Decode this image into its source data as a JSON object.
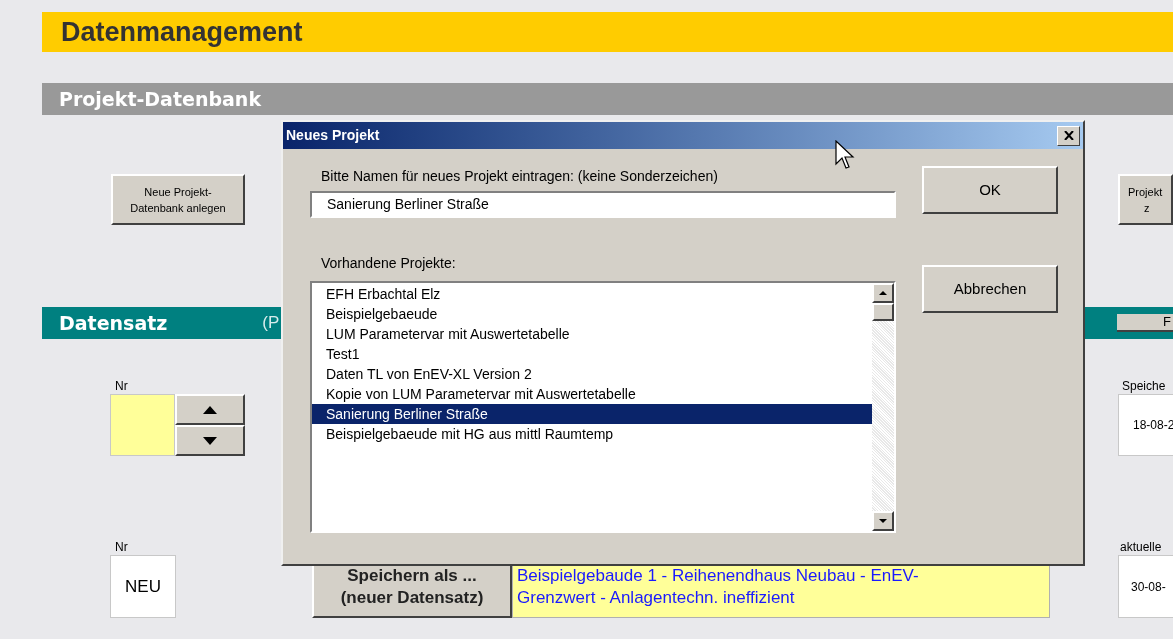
{
  "page_title": "Datenmanagement",
  "project_db": {
    "title": "Projekt-Datenbank",
    "buttons": [
      {
        "lines": [
          "Neue Projekt-",
          "Datenbank anlegen"
        ]
      },
      {
        "lines": [
          "Projekt",
          "z"
        ]
      }
    ]
  },
  "record": {
    "title": "Datensatz",
    "subtitle": "(P",
    "button": "F",
    "nr_label": "Nr",
    "saved_label": "Speiche",
    "saved_value": "18-08-2",
    "new_nr_label": "Nr",
    "new_nr_value": "NEU",
    "save_as_button": [
      "Speichern als ...",
      "(neuer Datensatz)"
    ],
    "description": "Beispielgebaude 1 - Reihenendhaus Neubau - EnEV-Grenzwert - Anlagentechn. ineffizient",
    "current_label": "aktuelle",
    "current_value": "30-08-"
  },
  "dialog": {
    "title": "Neues Projekt",
    "prompt": "Bitte Namen für neues Projekt eintragen: (keine Sonderzeichen)",
    "name_value": "Sanierung Berliner Straße",
    "list_label": "Vorhandene Projekte:",
    "projects": [
      {
        "name": "EFH Erbachtal Elz",
        "selected": false
      },
      {
        "name": "Beispielgebaeude",
        "selected": false
      },
      {
        "name": "LUM Parametervar mit Auswertetabelle",
        "selected": false
      },
      {
        "name": "Test1",
        "selected": false
      },
      {
        "name": "Daten TL von EnEV-XL Version 2",
        "selected": false
      },
      {
        "name": "Kopie von LUM Parametervar mit Auswertetabelle",
        "selected": false
      },
      {
        "name": "Sanierung Berliner Straße",
        "selected": true
      },
      {
        "name": "Beispielgebaeude mit HG aus mittl Raumtemp",
        "selected": false
      }
    ],
    "buttons": [
      "OK",
      "Abbrechen"
    ]
  }
}
